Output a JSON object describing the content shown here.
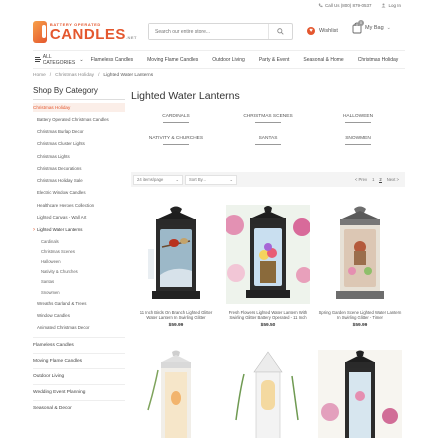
{
  "topbar": {
    "phone": "Call Us (800) 879-0537",
    "login": "Log In"
  },
  "logo": {
    "top": "BATTERY OPERATED",
    "main": "CANDLES",
    "suffix": ".NET"
  },
  "search": {
    "placeholder": "Search our entire store..."
  },
  "header": {
    "wishlist": "Wishlist",
    "bag": "My Bag",
    "bag_count": "0"
  },
  "nav": {
    "all": "ALL CATEGORIES",
    "items": [
      "Flameless Candles",
      "Moving Flame Candles",
      "Outdoor Living",
      "Party & Event",
      "Seasonal & Home",
      "Christmas Holiday"
    ]
  },
  "breadcrumb": [
    "Home",
    "Christmas Holiday",
    "Lighted Water Lanterns"
  ],
  "sidebar": {
    "title": "Shop By Category",
    "top": "Christmas Holiday",
    "items": [
      "Battery Operated Christmas Candles",
      "Christmas Burlap Decor",
      "Christmas Cluster Lights",
      "Christmas Lights",
      "Christmas Decorations",
      "Christmas Holiday Sale",
      "Electric Window Candles",
      "Healthcare Heroes Collection",
      "Lighted Canvas - Wall Art",
      "Lighted Water Lanterns"
    ],
    "sub": [
      "Cardinals",
      "Christmas Scenes",
      "Halloween",
      "Nativity & Churches",
      "Santas",
      "Snowmen"
    ],
    "after": [
      "Wreaths Garland & Trees",
      "Window Candles",
      "Animated Christmas Decor"
    ],
    "main": [
      "Flameless Candles",
      "Moving Flame Candles",
      "Outdoor Living",
      "Wedding Event Planning",
      "Seasonal & Decor"
    ]
  },
  "page": {
    "title": "Lighted Water Lanterns",
    "subcats": [
      "CARDINALS",
      "CHRISTMAS SCENES",
      "HALLOWEEN",
      "NATIVITY & CHURCHES",
      "SANTAS",
      "SNOWMEN"
    ]
  },
  "toolbar": {
    "per_page": "24 items/page",
    "sort": "Sort By...",
    "prev": "< Prev",
    "pages": [
      "1",
      "2"
    ],
    "next": "Next >"
  },
  "products": [
    {
      "name": "11 Inch Birds On Branch Lighted Glitter Water Lantern In Swirling Glitter",
      "price": "$59.99"
    },
    {
      "name": "Fresh Flowers Lighted Water Lantern With Swirling Glitter Battery Operated - 11 Inch",
      "price": "$59.50"
    },
    {
      "name": "Spring Garden Scene Lighted Water Lantern In Swirling Glitter - Timer",
      "price": "$59.99"
    },
    {
      "name": "",
      "price": ""
    },
    {
      "name": "",
      "price": ""
    },
    {
      "name": "",
      "price": ""
    }
  ],
  "colors": {
    "accent": "#e4572e",
    "highlight_bg": "#fbeee8"
  }
}
